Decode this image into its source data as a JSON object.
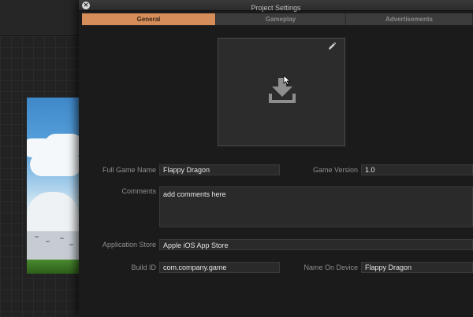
{
  "dialog": {
    "title": "Project Settings",
    "close_glyph": "✕"
  },
  "tabs": [
    {
      "label": "General",
      "active": true
    },
    {
      "label": "Gameplay",
      "active": false
    },
    {
      "label": "Advertisements",
      "active": false
    }
  ],
  "icon_area": {
    "edit_icon": "pencil-icon",
    "drop_icon": "download-icon"
  },
  "form": {
    "full_game_name": {
      "label": "Full Game Name",
      "value": "Flappy Dragon"
    },
    "game_version": {
      "label": "Game Version",
      "value": "1.0"
    },
    "comments": {
      "label": "Comments",
      "value": "add comments here"
    },
    "application_store": {
      "label": "Application Store",
      "value": "Apple iOS App Store"
    },
    "build_id": {
      "label": "Build ID",
      "value": "com.company.game"
    },
    "name_on_device": {
      "label": "Name On Device",
      "value": "Flappy Dragon"
    }
  },
  "colors": {
    "active_tab": "#d58d5a",
    "background": "#1b1b1b",
    "field": "#2a2a2a"
  }
}
